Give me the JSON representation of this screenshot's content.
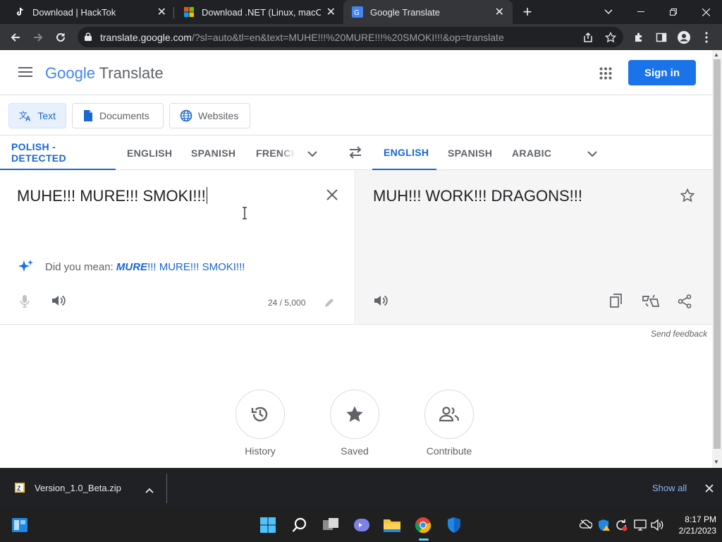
{
  "browser": {
    "tabs": [
      {
        "title": "Download | HackTok",
        "icon": "tiktok-icon"
      },
      {
        "title": "Download .NET (Linux, macOS, and Windows)",
        "icon": "microsoft-icon"
      },
      {
        "title": "Google Translate",
        "icon": "google-translate-icon"
      }
    ],
    "url_domain": "translate.google.com",
    "url_rest": "/?sl=auto&tl=en&text=MUHE!!!%20MURE!!!%20SMOKI!!!&op=translate"
  },
  "header": {
    "logo_google": "Google",
    "logo_translate": "Translate",
    "sign_in": "Sign in"
  },
  "modes": {
    "text": "Text",
    "documents": "Documents",
    "websites": "Websites"
  },
  "source_langs": [
    "POLISH - DETECTED",
    "ENGLISH",
    "SPANISH",
    "FRENCH"
  ],
  "target_langs": [
    "ENGLISH",
    "SPANISH",
    "ARABIC"
  ],
  "source": {
    "text": "MUHE!!! MURE!!! SMOKI!!!",
    "did_you_mean_label": "Did you mean:",
    "suggestion_bold": "MURE",
    "suggestion_rest": "!!! MURE!!! SMOKI!!!",
    "char_count": "24 / 5,000"
  },
  "target": {
    "text": "MUH!!! WORK!!! DRAGONS!!!"
  },
  "feedback": "Send feedback",
  "bottom_actions": {
    "history": "History",
    "saved": "Saved",
    "contribute": "Contribute"
  },
  "download": {
    "filename": "Version_1.0_Beta.zip",
    "show_all": "Show all"
  },
  "taskbar": {
    "time": "8:17 PM",
    "date": "2/21/2023"
  },
  "colors": {
    "accent": "#1a73e8",
    "selected_bg": "#e8f0fe"
  }
}
